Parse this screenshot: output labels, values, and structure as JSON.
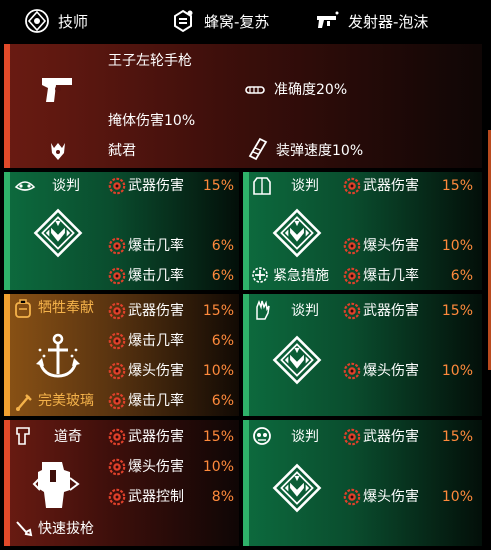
{
  "header": {
    "specialization": "技师",
    "skill1": "蜂窝-复苏",
    "skill2": "发射器-泡沫"
  },
  "weapon": {
    "name": "王子左轮手枪",
    "talent": "弑君",
    "attr1": "掩体伤害10%",
    "attr2": "准确度20%",
    "attr3": "装弹速度10%"
  },
  "cards": [
    {
      "title": "谈判",
      "rows": [
        {
          "label": "武器伤害",
          "value": "15%"
        },
        {
          "label": "爆击几率",
          "value": "6%"
        },
        {
          "label": "爆击几率",
          "value": "6%"
        }
      ]
    },
    {
      "title": "谈判",
      "rows": [
        {
          "label": "武器伤害",
          "value": "15%"
        },
        {
          "label": "爆头伤害",
          "value": "10%"
        },
        {
          "label": "爆击几率",
          "value": "6%"
        }
      ],
      "talent": "紧急措施"
    },
    {
      "title": "牺牲奉献",
      "rows": [
        {
          "label": "武器伤害",
          "value": "15%"
        },
        {
          "label": "爆击几率",
          "value": "6%"
        },
        {
          "label": "爆头伤害",
          "value": "10%"
        },
        {
          "label": "爆击几率",
          "value": "6%"
        }
      ],
      "talent": "完美玻璃"
    },
    {
      "title": "谈判",
      "rows": [
        {
          "label": "武器伤害",
          "value": "15%"
        },
        {
          "label": "爆头伤害",
          "value": "10%"
        }
      ]
    },
    {
      "title": "道奇",
      "rows": [
        {
          "label": "武器伤害",
          "value": "15%"
        },
        {
          "label": "爆头伤害",
          "value": "10%"
        },
        {
          "label": "武器控制",
          "value": "8%"
        }
      ],
      "talent": "快速拔枪"
    },
    {
      "title": "谈判",
      "rows": [
        {
          "label": "武器伤害",
          "value": "15%"
        },
        {
          "label": "爆头伤害",
          "value": "10%"
        }
      ]
    }
  ],
  "colors": {
    "accent_value": "#ff8a3c",
    "red_bar": "#e04a2a",
    "green_bar": "#2fb26a",
    "orange_bar": "#f0a030"
  }
}
